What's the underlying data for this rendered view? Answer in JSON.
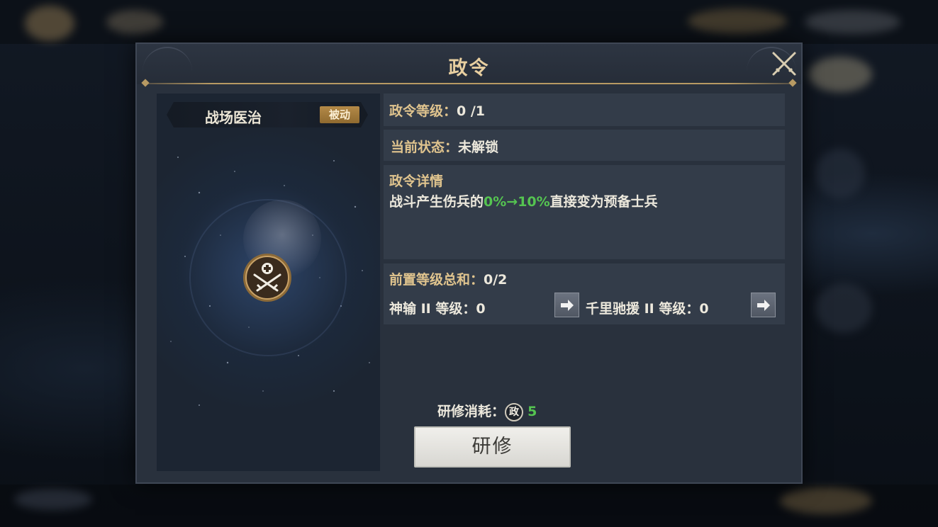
{
  "dialog": {
    "title": "政令"
  },
  "skill": {
    "name": "战场医治",
    "type_badge": "被动",
    "icon": "crossed-swords-medic-icon"
  },
  "level": {
    "label": "政令等级：",
    "value": "0 /1"
  },
  "status": {
    "label": "当前状态：",
    "value": "未解锁"
  },
  "details": {
    "heading": "政令详情",
    "desc_before": "战斗产生伤兵的",
    "desc_highlight": "0%→10%",
    "desc_after": "直接变为预备士兵"
  },
  "prereq": {
    "total_label": "前置等级总和：",
    "total_value": "0/2",
    "items": [
      {
        "label": "神输 II 等级：",
        "value": "0"
      },
      {
        "label": "千里驰援 II 等级：",
        "value": "0"
      }
    ]
  },
  "cost": {
    "label": "研修消耗：",
    "icon_char": "政",
    "amount": "5"
  },
  "research_button": {
    "label": "研修"
  },
  "colors": {
    "gold": "#e0c48e",
    "highlight_green": "#55c451",
    "badge": "#b48a48"
  }
}
